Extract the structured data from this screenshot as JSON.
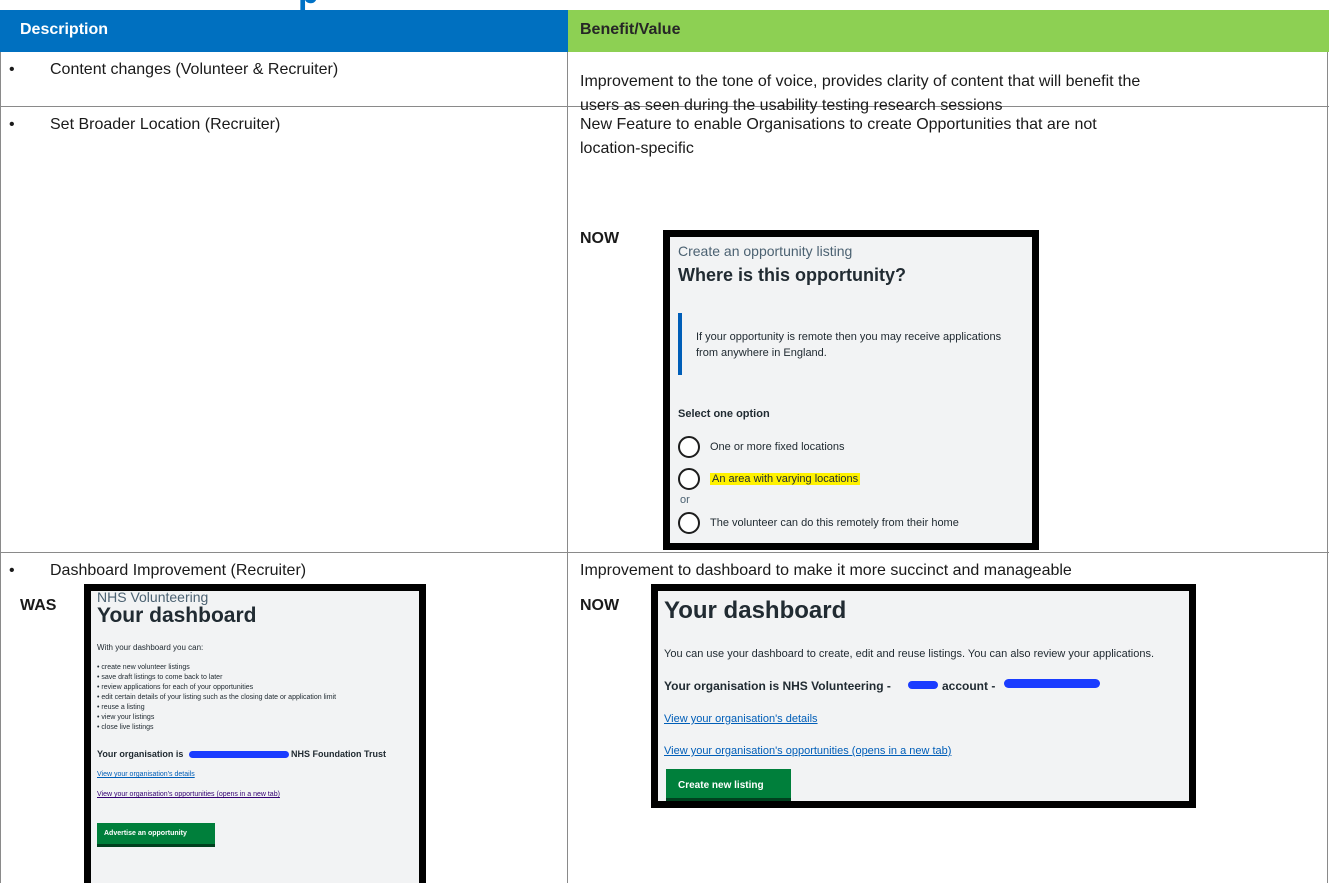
{
  "header": {
    "description": "Description",
    "benefit": "Benefit/Value"
  },
  "rows": [
    {
      "bullet": "•",
      "description": "Content changes (Volunteer & Recruiter)",
      "benefit_lines": [
        "Improvement to the tone of voice, provides clarity of content that will benefit the",
        "users as seen during the usability testing research sessions"
      ]
    },
    {
      "bullet": "•",
      "description": "Set Broader Location (Recruiter)",
      "benefit_lines": [
        "New Feature to enable Organisations to create Opportunities that are not",
        "location-specific"
      ],
      "now_label": "NOW",
      "screenshot": {
        "caption": "Create an opportunity listing",
        "heading": "Where is this opportunity?",
        "inset_lines": [
          "If your opportunity is remote then you may receive applications",
          "from anywhere in England."
        ],
        "legend": "Select one option",
        "options": [
          "One or more fixed locations",
          "An area with varying locations",
          "The volunteer can do this remotely from their home"
        ],
        "or_text": "or"
      }
    },
    {
      "bullet": "•",
      "description": "Dashboard Improvement (Recruiter)",
      "benefit_lines": [
        "Improvement to dashboard to make it more succinct and manageable"
      ],
      "was_label": "WAS",
      "now_label": "NOW",
      "was_screenshot": {
        "caption": "NHS Volunteering",
        "heading": "Your dashboard",
        "intro": "With your dashboard you can:",
        "items": [
          "create new volunteer listings",
          "save draft listings to come back to later",
          "review applications for each of your opportunities",
          "edit certain details of your listing such as the closing date or application limit",
          "reuse a listing",
          "view your listings",
          "close live listings"
        ],
        "org_prefix": "Your organisation is",
        "org_suffix": "NHS Foundation Trust",
        "link1": "View your organisation's details",
        "link2": "View your organisation's opportunities (opens in a new tab)",
        "button": "Advertise an opportunity"
      },
      "now_screenshot": {
        "heading": "Your dashboard",
        "intro": "You can use your dashboard to create, edit and reuse listings. You can also review your applications.",
        "org_prefix": "Your organisation is NHS Volunteering -",
        "org_mid": "account -",
        "link1": "View your organisation's details",
        "link2": "View your organisation's opportunities (opens in a new tab)",
        "button": "Create new listing"
      }
    }
  ],
  "colors": {
    "header_description_bg": "#0070c0",
    "header_benefit_bg": "#8dd053",
    "highlight": "#fff200",
    "nhs_blue": "#005eb8",
    "nhs_green": "#007f3b"
  }
}
